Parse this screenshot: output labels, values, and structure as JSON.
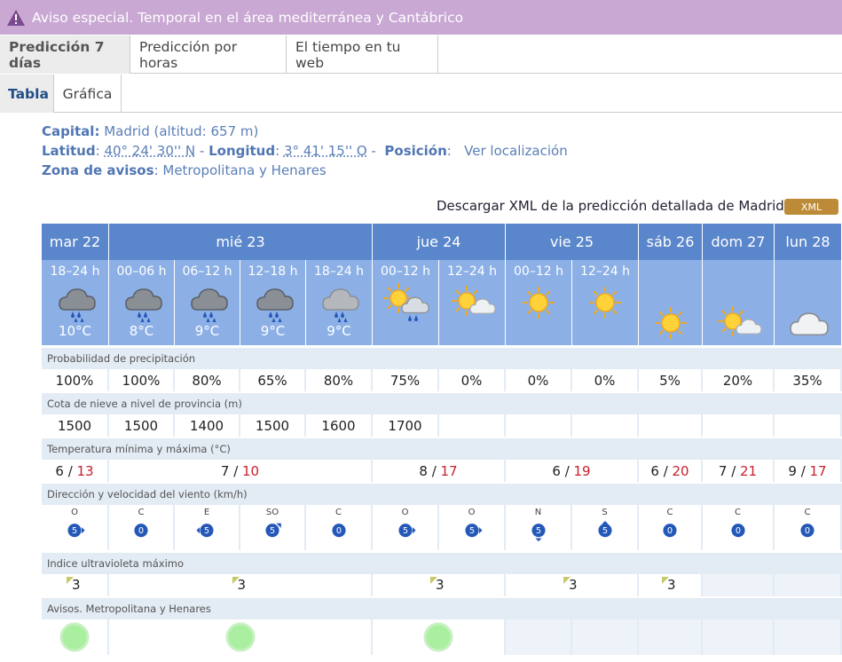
{
  "alert": {
    "text": "Aviso especial. Temporal en el área mediterránea y Cantábrico"
  },
  "tabs_primary": [
    {
      "label": "Predicción 7 días",
      "active": true
    },
    {
      "label": "Predicción por horas",
      "active": false
    },
    {
      "label": "El tiempo en tu web",
      "active": false
    }
  ],
  "tabs_secondary": [
    {
      "label": "Tabla",
      "active": true
    },
    {
      "label": "Gráfica",
      "active": false
    }
  ],
  "location": {
    "capital_label": "Capital:",
    "capital_value": "Madrid (altitud: 657 m)",
    "lat_label": "Latitud",
    "lat_value": "40° 24' 30'' N",
    "lon_label": "Longitud",
    "lon_value": "3° 41' 15'' O",
    "pos_label": "Posición",
    "pos_link": "Ver localización",
    "zone_label": "Zona de avisos",
    "zone_value": "Metropolitana y Henares",
    "sep1": ":",
    "sep2": "-",
    "sep3": "-",
    "sep4": ":",
    "sep5": ":"
  },
  "download": {
    "text": "Descargar XML de la predicción detallada de Madrid",
    "button": "XML"
  },
  "days": [
    "mar 22",
    "mié 23",
    "jue 24",
    "vie 25",
    "sáb 26",
    "dom 27",
    "lun 28"
  ],
  "periods": [
    {
      "label": "18–24 h",
      "icon": "rain-cloud-icon",
      "temp": "10°C"
    },
    {
      "label": "00–06 h",
      "icon": "rain-cloud-icon",
      "temp": "8°C"
    },
    {
      "label": "06–12 h",
      "icon": "rain-cloud-icon",
      "temp": "9°C"
    },
    {
      "label": "12–18 h",
      "icon": "rain-cloud-icon",
      "temp": "9°C"
    },
    {
      "label": "18–24 h",
      "icon": "rain-cloud-light-icon",
      "temp": "9°C"
    },
    {
      "label": "00–12 h",
      "icon": "sun-rain-cloud-icon",
      "temp": ""
    },
    {
      "label": "12–24 h",
      "icon": "sun-cloud-icon",
      "temp": ""
    },
    {
      "label": "00–12 h",
      "icon": "sun-icon",
      "temp": ""
    },
    {
      "label": "12–24 h",
      "icon": "sun-icon",
      "temp": ""
    },
    {
      "label": "",
      "icon": "sun-icon",
      "temp": ""
    },
    {
      "label": "",
      "icon": "sun-cloud-icon",
      "temp": ""
    },
    {
      "label": "",
      "icon": "cloud-icon",
      "temp": ""
    }
  ],
  "rows": {
    "precip_label": "Probabilidad de precipitación",
    "precip": [
      "100%",
      "100%",
      "80%",
      "65%",
      "80%",
      "75%",
      "0%",
      "0%",
      "0%",
      "5%",
      "20%",
      "35%"
    ],
    "snow_label": "Cota de nieve a nivel de provincia (m)",
    "snow": [
      "1500",
      "1500",
      "1400",
      "1500",
      "1600",
      "1700",
      "",
      "",
      "",
      "",
      "",
      ""
    ],
    "temp_label": "Temperatura mínima y máxima (°C)",
    "temps": [
      {
        "min": "6",
        "max": "13"
      },
      {
        "min": "7",
        "max": "10"
      },
      {
        "min": "8",
        "max": "17"
      },
      {
        "min": "6",
        "max": "19"
      },
      {
        "min": "6",
        "max": "20"
      },
      {
        "min": "7",
        "max": "21"
      },
      {
        "min": "9",
        "max": "17"
      }
    ],
    "wind_label": "Dirección y velocidad del viento (km/h)",
    "wind": [
      {
        "dir": "O",
        "speed": "5"
      },
      {
        "dir": "C",
        "speed": "0"
      },
      {
        "dir": "E",
        "speed": "5"
      },
      {
        "dir": "SO",
        "speed": "5"
      },
      {
        "dir": "C",
        "speed": "0"
      },
      {
        "dir": "O",
        "speed": "5"
      },
      {
        "dir": "O",
        "speed": "5"
      },
      {
        "dir": "N",
        "speed": "5"
      },
      {
        "dir": "S",
        "speed": "5"
      },
      {
        "dir": "C",
        "speed": "0"
      },
      {
        "dir": "C",
        "speed": "0"
      },
      {
        "dir": "C",
        "speed": "0"
      }
    ],
    "uv_label": "Indice ultravioleta máximo",
    "uv": [
      "3",
      "3",
      "3",
      "3",
      "3"
    ],
    "warn_label": "Avisos. Metropolitana y Henares"
  },
  "colors": {
    "header": "#5a86cc",
    "period": "#8cb0e6",
    "max_temp": "#c8202c",
    "warn_green": "#9be89b",
    "alert_bg": "#c9a8d3"
  }
}
